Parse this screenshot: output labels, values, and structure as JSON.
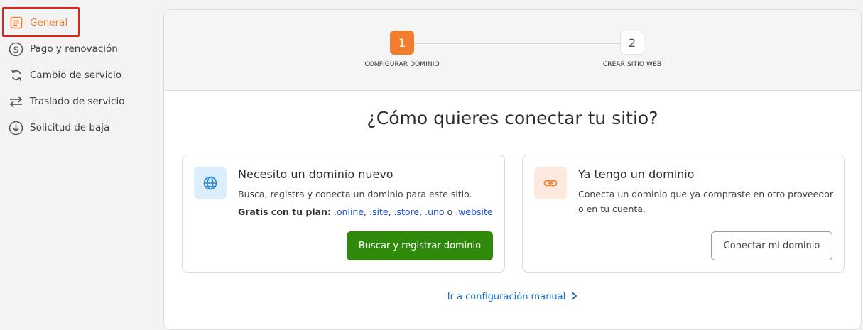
{
  "sidebar": {
    "items": [
      {
        "label": "General",
        "icon": "document-icon",
        "active": true
      },
      {
        "label": "Pago y renovación",
        "icon": "dollar-icon",
        "active": false
      },
      {
        "label": "Cambio de servicio",
        "icon": "refresh-icon",
        "active": false
      },
      {
        "label": "Traslado de servicio",
        "icon": "transfer-icon",
        "active": false
      },
      {
        "label": "Solicitud de baja",
        "icon": "download-circle-icon",
        "active": false
      }
    ]
  },
  "stepper": {
    "steps": [
      {
        "number": "1",
        "label": "CONFIGURAR DOMINIO",
        "active": true
      },
      {
        "number": "2",
        "label": "CREAR SITIO WEB",
        "active": false
      }
    ]
  },
  "main": {
    "heading": "¿Cómo quieres conectar tu sitio?",
    "options": [
      {
        "title": "Necesito un dominio nuevo",
        "description": "Busca, registra y conecta un dominio para este sitio.",
        "free_label": "Gratis con tu plan:",
        "tlds": [
          ".online",
          ".site",
          ".store",
          ".uno",
          ".website"
        ],
        "sep_comma": ",",
        "sep_or": "o",
        "button": "Buscar y registrar dominio",
        "icon": "globe-icon"
      },
      {
        "title": "Ya tengo un dominio",
        "description": "Conecta un dominio que ya compraste en otro proveedor o en tu cuenta.",
        "button": "Conectar mi dominio",
        "icon": "link-icon"
      }
    ],
    "manual_link": "Ir a configuración manual"
  },
  "colors": {
    "accent": "#f47d2d",
    "primary_button": "#2f8a0c",
    "link": "#1a6fc9",
    "tld": "#1a4ed8"
  }
}
